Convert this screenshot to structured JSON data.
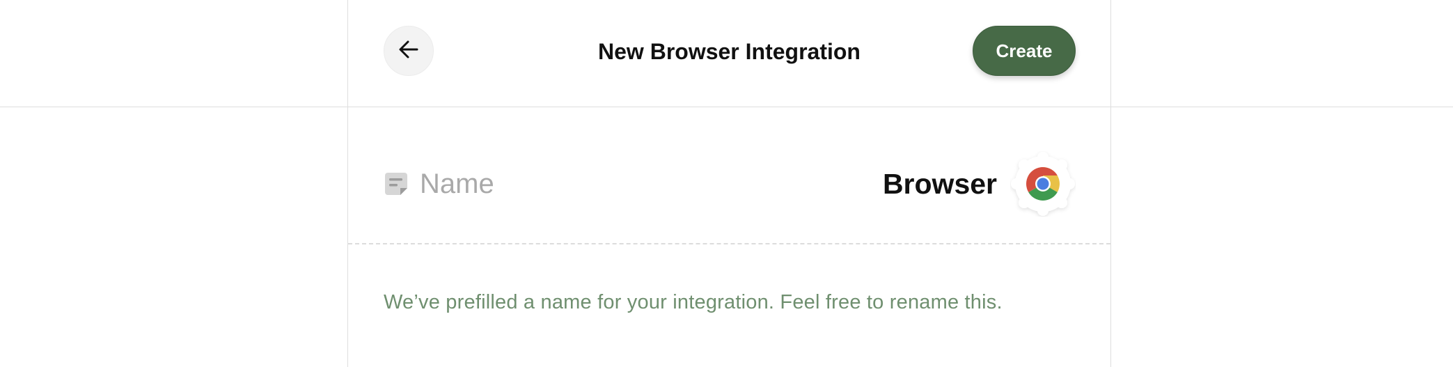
{
  "header": {
    "title": "New Browser Integration",
    "create_label": "Create"
  },
  "form": {
    "name_placeholder": "Name",
    "name_value": "",
    "integration_type": "Browser",
    "hint": "We’ve prefilled a name for your integration. Feel free to rename this."
  },
  "icons": {
    "back": "arrow-left-icon",
    "name": "label-tag-icon",
    "type": "chrome-icon"
  },
  "colors": {
    "accent": "#476a47",
    "hint_text": "#6f8f6f",
    "placeholder": "#a9a9a9"
  }
}
